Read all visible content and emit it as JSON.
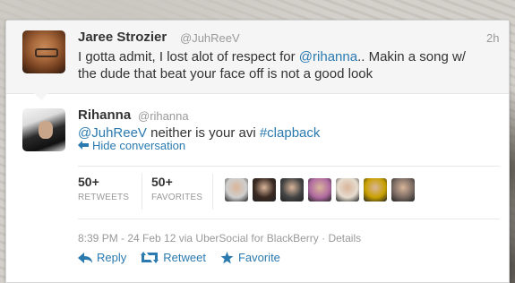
{
  "parent_tweet": {
    "name": "Jaree Strozier",
    "handle": "@JuhReeV",
    "time": "2h",
    "text_before": "I gotta admit, I lost alot of respect for ",
    "mention": "@rihanna",
    "text_after": ".. Makin a song w/",
    "line2": "the dude that beat your face off is not a good look"
  },
  "tweet": {
    "name": "Rihanna",
    "handle": "@rihanna",
    "mention": "@JuhReeV",
    "text": " neither is your avi ",
    "hashtag": "#clapback",
    "hide_conversation": "Hide conversation"
  },
  "stats": {
    "retweets_count": "50+",
    "retweets_label": "RETWEETS",
    "favorites_count": "50+",
    "favorites_label": "FAVORITES"
  },
  "favoriter_avatars": [
    {
      "color": "#cfcfcf"
    },
    {
      "color": "#3a2a22"
    },
    {
      "color": "#444444"
    },
    {
      "color": "#b06aa0"
    },
    {
      "color": "#e6dccf"
    },
    {
      "color": "#c8a000"
    },
    {
      "color": "#7a6a62"
    }
  ],
  "meta": "8:39 PM - 24 Feb 12 via UberSocial for BlackBerry · Details",
  "actions": {
    "reply": "Reply",
    "retweet": "Retweet",
    "favorite": "Favorite"
  },
  "colors": {
    "link": "#2a7ab0",
    "text": "#333333",
    "muted": "#999999"
  }
}
